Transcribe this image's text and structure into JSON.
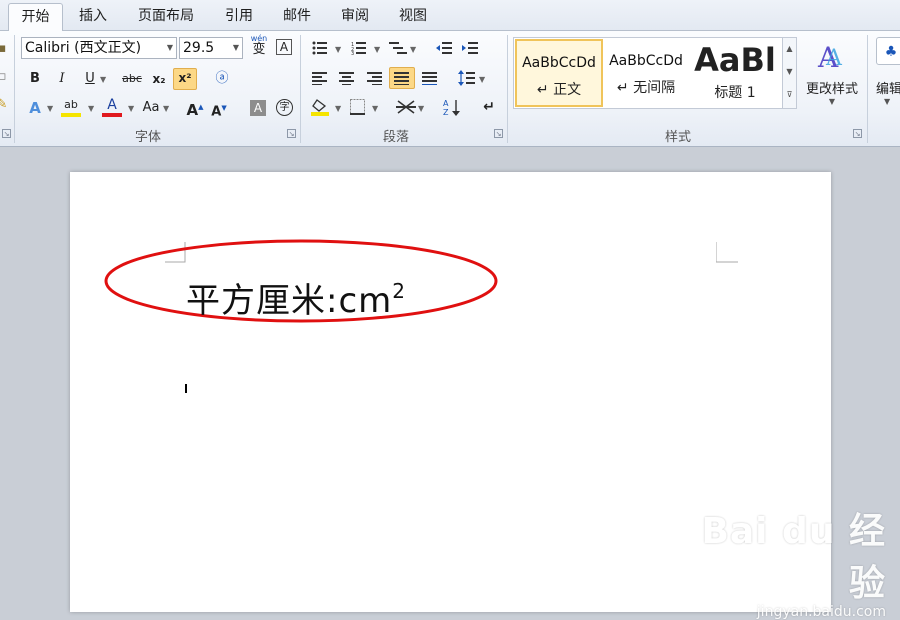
{
  "tabs": [
    "开始",
    "插入",
    "页面布局",
    "引用",
    "邮件",
    "审阅",
    "视图"
  ],
  "font": {
    "name": "Calibri (西文正文)",
    "size": "29.5",
    "group_label": "字体",
    "wen_label": "wén",
    "wen_char": "变",
    "border_char": "A",
    "bold": "B",
    "italic": "I",
    "underline": "U",
    "strike": "abc",
    "subscript": "x₂",
    "superscript": "x²",
    "text_effect": "A",
    "highlight": "ab",
    "font_color": "A",
    "change_case": "Aa",
    "grow": "A",
    "shrink": "A",
    "char_shading": "A",
    "enclose": "字",
    "highlight_color": "#f5e400",
    "font_color_value": "#e0191f"
  },
  "paragraph": {
    "group_label": "段落"
  },
  "styles": {
    "group_label": "样式",
    "items": [
      {
        "sample": "AaBbCcDd",
        "name": "↵ 正文"
      },
      {
        "sample": "AaBbCcDd",
        "name": "↵ 无间隔"
      },
      {
        "sample": "AaBl",
        "name": "标题 1"
      }
    ],
    "change_styles": "更改样式",
    "edit": "编辑"
  },
  "document": {
    "text": "平方厘米:cm",
    "superscript": "2",
    "ellipse_color": "#e01010"
  },
  "watermark": {
    "main": "Bai du 经验",
    "url": "jingyan.baidu.com"
  }
}
